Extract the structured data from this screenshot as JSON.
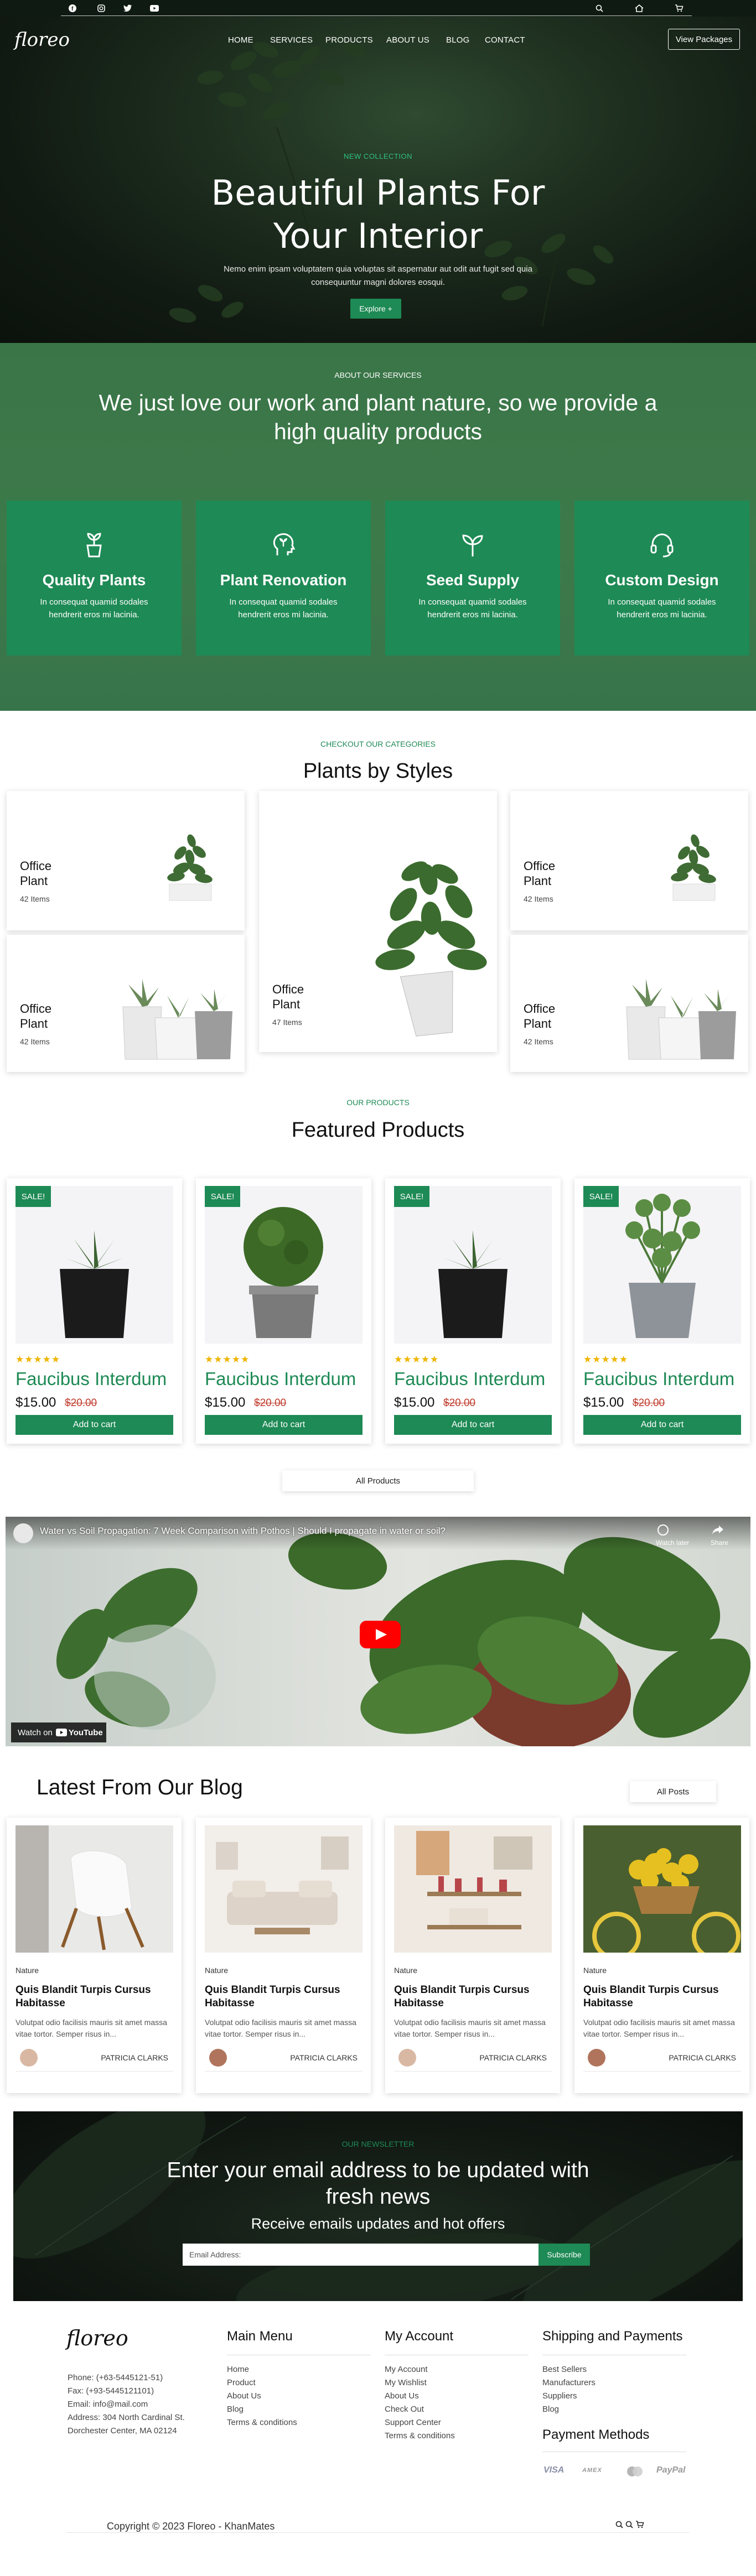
{
  "topbar": {
    "social_icons": [
      "facebook-icon",
      "instagram-icon",
      "twitter-icon",
      "youtube-icon"
    ],
    "utility_icons": [
      "search-icon",
      "home-icon",
      "cart-icon"
    ]
  },
  "brand": {
    "logo": "floreo"
  },
  "nav": {
    "items": [
      "HOME",
      "SERVICES",
      "PRODUCTS",
      "ABOUT US",
      "BLOG",
      "CONTACT"
    ],
    "cta": "View Packages"
  },
  "hero": {
    "subtitle": "NEW COLLECTION",
    "title": "Beautiful Plants For Your Interior",
    "description": "Nemo enim ipsam voluptatem quia voluptas sit aspernatur aut odit aut fugit sed quia consequuntur magni dolores eosqui.",
    "button": "Explore +"
  },
  "services": {
    "subtitle": "ABOUT OUR SERVICES",
    "title": "We just love our work and plant nature, so we provide a high quality products",
    "cards": [
      {
        "icon": "sprout-pot-icon",
        "title": "Quality Plants",
        "desc": "In consequat quamid sodales hendrerit eros mi lacinia."
      },
      {
        "icon": "plant-head-icon",
        "title": "Plant Renovation",
        "desc": "In consequat quamid sodales hendrerit eros mi lacinia."
      },
      {
        "icon": "seedling-icon",
        "title": "Seed Supply",
        "desc": "In consequat quamid sodales hendrerit eros mi lacinia."
      },
      {
        "icon": "headset-icon",
        "title": "Custom Design",
        "desc": "In consequat quamid sodales hendrerit eros mi lacinia."
      }
    ]
  },
  "categories": {
    "subtitle": "CHECKOUT OUR CATEGORIES",
    "title": "Plants by Styles",
    "items": [
      {
        "name": "Office Plant",
        "count": "42 Items"
      },
      {
        "name": "Office Plant",
        "count": "42 Items"
      },
      {
        "name": "Office Plant",
        "count": "47 Items"
      },
      {
        "name": "Office Plant",
        "count": "42 Items"
      },
      {
        "name": "Office Plant",
        "count": "42 Items"
      }
    ]
  },
  "products": {
    "subtitle": "OUR PRODUCTS",
    "title": "Featured Products",
    "sale_label": "SALE!",
    "stars": "★★★★★",
    "rating": 5,
    "items": [
      {
        "name": "Faucibus Interdum",
        "price": "$15.00",
        "old_price": "$20.00",
        "button": "Add to cart"
      },
      {
        "name": "Faucibus Interdum",
        "price": "$15.00",
        "old_price": "$20.00",
        "button": "Add to cart"
      },
      {
        "name": "Faucibus Interdum",
        "price": "$15.00",
        "old_price": "$20.00",
        "button": "Add to cart"
      },
      {
        "name": "Faucibus Interdum",
        "price": "$15.00",
        "old_price": "$20.00",
        "button": "Add to cart"
      }
    ],
    "all_button": "All Products"
  },
  "video": {
    "title": "Water vs Soil Propagation: 7 Week Comparison with Pothos | Should I propagate in water or soil?",
    "watch_later": "Watch later",
    "share": "Share",
    "watch_on": "Watch on",
    "youtube": "YouTube"
  },
  "blog": {
    "title": "Latest From Our Blog",
    "all_button": "All Posts",
    "posts": [
      {
        "category": "Nature",
        "title": "Quis Blandit Turpis Cursus Habitasse",
        "desc": "Volutpat odio facilisis mauris sit amet massa vitae tortor. Semper risus in...",
        "author": "PATRICIA CLARKS"
      },
      {
        "category": "Nature",
        "title": "Quis Blandit Turpis Cursus Habitasse",
        "desc": "Volutpat odio facilisis mauris sit amet massa vitae tortor. Semper risus in...",
        "author": "PATRICIA CLARKS"
      },
      {
        "category": "Nature",
        "title": "Quis Blandit Turpis Cursus Habitasse",
        "desc": "Volutpat odio facilisis mauris sit amet massa vitae tortor. Semper risus in...",
        "author": "PATRICIA CLARKS"
      },
      {
        "category": "Nature",
        "title": "Quis Blandit Turpis Cursus Habitasse",
        "desc": "Volutpat odio facilisis mauris sit amet massa vitae tortor. Semper risus in...",
        "author": "PATRICIA CLARKS"
      }
    ]
  },
  "newsletter": {
    "subtitle": "OUR NEWSLETTER",
    "title": "Enter your email address to be updated with fresh news",
    "subtitle2": "Receive emails updates and hot offers",
    "placeholder": "Email Address:",
    "button": "Subscribe"
  },
  "footer": {
    "logo": "floreo",
    "contact": [
      "Phone: (+63-5445121-51)",
      "Fax: (+93-5445121101)",
      "Email: info@mail.com",
      "Address: 304 North Cardinal St.",
      "Dorchester Center, MA 02124"
    ],
    "main_menu": {
      "title": "Main Menu",
      "items": [
        "Home",
        "Product",
        "About Us",
        "Blog",
        "Terms & conditions"
      ]
    },
    "my_account": {
      "title": "My Account",
      "items": [
        "My Account",
        "My Wishlist",
        "About Us",
        "Check Out",
        "Support Center",
        "Terms & conditions"
      ]
    },
    "shipping": {
      "title": "Shipping and Payments",
      "items": [
        "Best Sellers",
        "Manufacturers",
        "Suppliers",
        "Blog"
      ]
    },
    "payment": {
      "title": "Payment Methods",
      "items": [
        "VISA",
        "AMEX",
        "MC",
        "PayPal"
      ]
    },
    "copyright": "Copyright © 2023 Floreo - KhanMates"
  },
  "colors": {
    "accent": "#1e8a55",
    "services_bg": "#3a7547",
    "dark": "#0f1a12"
  }
}
